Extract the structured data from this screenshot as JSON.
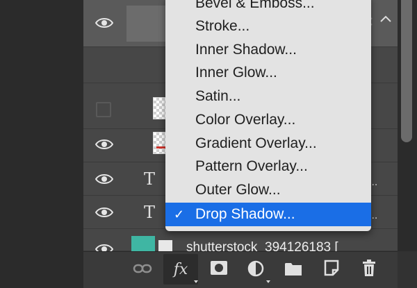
{
  "menu": {
    "items": [
      {
        "label": "Bevel & Emboss...",
        "checked": false
      },
      {
        "label": "Stroke...",
        "checked": false
      },
      {
        "label": "Inner Shadow...",
        "checked": false
      },
      {
        "label": "Inner Glow...",
        "checked": false
      },
      {
        "label": "Satin...",
        "checked": false
      },
      {
        "label": "Color Overlay...",
        "checked": false
      },
      {
        "label": "Gradient Overlay...",
        "checked": false
      },
      {
        "label": "Pattern Overlay...",
        "checked": false
      },
      {
        "label": "Outer Glow...",
        "checked": false
      },
      {
        "label": "Drop Shadow...",
        "checked": true
      }
    ],
    "check_glyph": "✓",
    "highlight_color": "#1a6ee6"
  },
  "layers": {
    "type_glyph": "T",
    "tail_text": "...",
    "image_layer_name": "shutterstock_394126183 [",
    "image_thumb_color": "#3fb6a3"
  },
  "toolbar": {
    "fx_label": "fx"
  }
}
